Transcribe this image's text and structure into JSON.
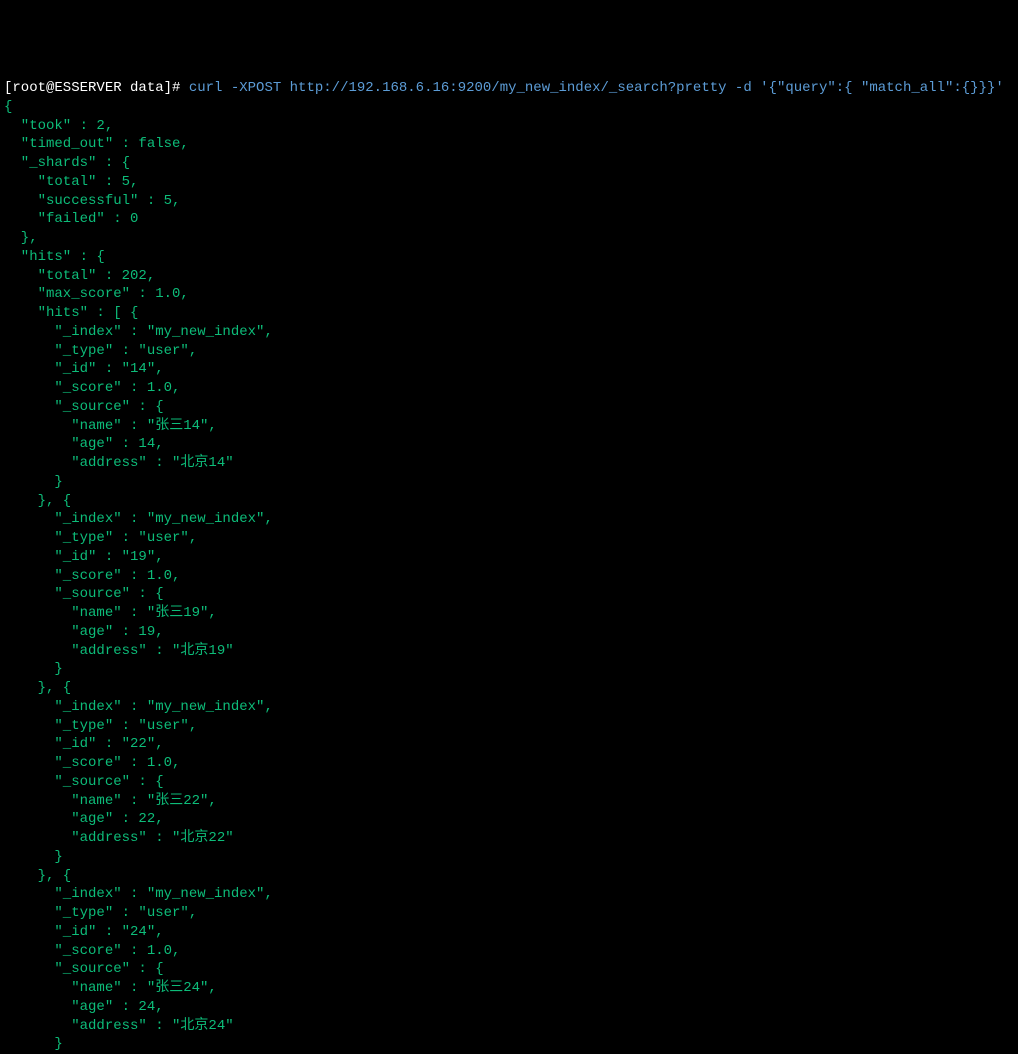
{
  "prompt": {
    "user_host": "[root@ESSERVER data]#",
    "command": "curl -XPOST http://192.168.6.16:9200/my_new_index/_search?pretty -d '{\"query\":{ \"match_all\":{}}}'"
  },
  "response": {
    "took": 2,
    "timed_out": "false",
    "_shards": {
      "total": 5,
      "successful": 5,
      "failed": 0
    },
    "hits": {
      "total": 202,
      "max_score": "1.0",
      "hits": [
        {
          "_index": "my_new_index",
          "_type": "user",
          "_id": "14",
          "_score": "1.0",
          "_source": {
            "name": "张三14",
            "age": 14,
            "address": "北京14"
          }
        },
        {
          "_index": "my_new_index",
          "_type": "user",
          "_id": "19",
          "_score": "1.0",
          "_source": {
            "name": "张三19",
            "age": 19,
            "address": "北京19"
          }
        },
        {
          "_index": "my_new_index",
          "_type": "user",
          "_id": "22",
          "_score": "1.0",
          "_source": {
            "name": "张三22",
            "age": 22,
            "address": "北京22"
          }
        },
        {
          "_index": "my_new_index",
          "_type": "user",
          "_id": "24",
          "_score": "1.0",
          "_source": {
            "name": "张三24",
            "age": 24,
            "address": "北京24"
          }
        }
      ]
    }
  }
}
